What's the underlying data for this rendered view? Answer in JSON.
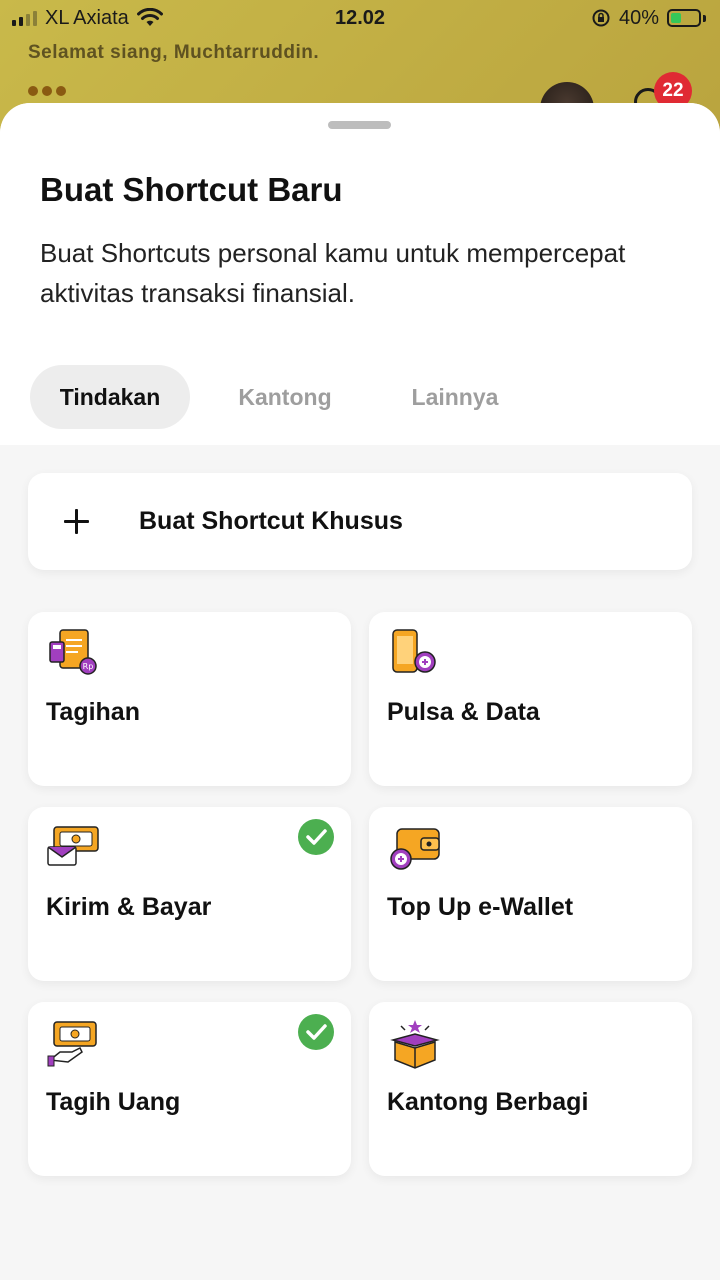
{
  "status_bar": {
    "carrier": "XL Axiata",
    "time": "12.02",
    "battery": "40%"
  },
  "background": {
    "greeting": "Selamat siang, Muchtarruddin.",
    "notification_count": "22"
  },
  "sheet": {
    "title": "Buat Shortcut Baru",
    "description": "Buat Shortcuts personal kamu untuk mempercepat aktivitas transaksi finansial.",
    "tabs": [
      {
        "label": "Tindakan",
        "active": true
      },
      {
        "label": "Kantong",
        "active": false
      },
      {
        "label": "Lainnya",
        "active": false
      }
    ],
    "custom_shortcut_label": "Buat Shortcut Khusus",
    "items": [
      {
        "label": "Tagihan",
        "icon": "bill-icon",
        "selected": false
      },
      {
        "label": "Pulsa & Data",
        "icon": "phone-topup-icon",
        "selected": false
      },
      {
        "label": "Kirim & Bayar",
        "icon": "send-money-icon",
        "selected": true
      },
      {
        "label": "Top Up e-Wallet",
        "icon": "wallet-topup-icon",
        "selected": false
      },
      {
        "label": "Tagih Uang",
        "icon": "request-money-icon",
        "selected": true
      },
      {
        "label": "Kantong Berbagi",
        "icon": "shared-pocket-icon",
        "selected": false
      }
    ]
  },
  "colors": {
    "accent_orange": "#f5a623",
    "accent_purple": "#8e24aa",
    "check_green": "#4caf50",
    "badge_red": "#e02a33"
  }
}
